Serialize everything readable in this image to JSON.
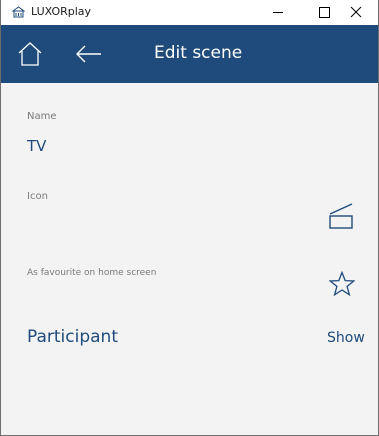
{
  "window": {
    "title": "LUXORplay"
  },
  "header": {
    "title": "Edit scene"
  },
  "form": {
    "name_label": "Name",
    "name_value": "TV",
    "icon_label": "Icon",
    "favourite_label": "As favourite on home screen",
    "participant_label": "Participant",
    "show_label": "Show"
  },
  "colors": {
    "accent": "#1e4b7c",
    "background": "#f3f3f3",
    "label": "#7a7a7a"
  },
  "icons": {
    "home": "home-icon",
    "back": "arrow-left-icon",
    "scene": "scene-icon",
    "favourite": "star-outline-icon"
  }
}
